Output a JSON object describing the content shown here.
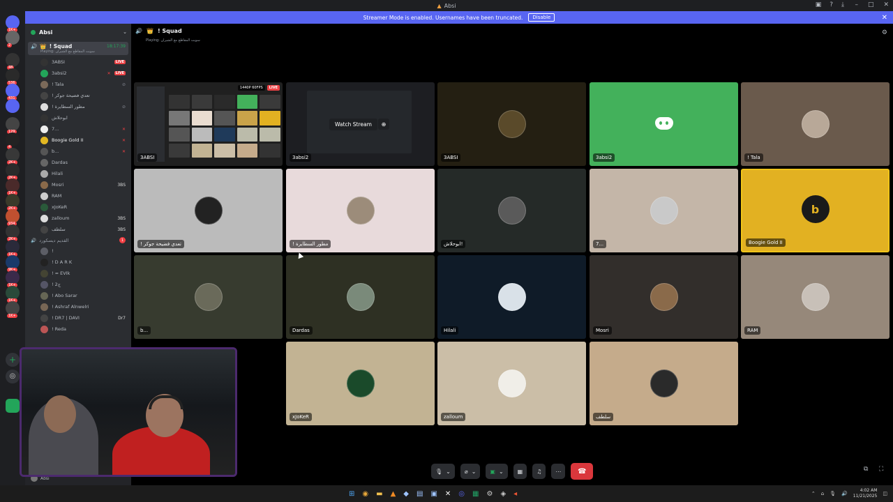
{
  "titlebar": {
    "title": "Absi"
  },
  "banner": {
    "text": "Streamer Mode is enabled. Usernames have been truncated.",
    "disable_label": "Disable"
  },
  "guild_badges": [
    "1K+",
    "2",
    "48",
    "536",
    "431",
    "129",
    "4",
    "2K+",
    "2K+",
    "1K+",
    "2K+",
    "934",
    "2K+",
    "1K+",
    "9K+",
    "1K+",
    "1K+",
    "1K+"
  ],
  "sidebar": {
    "server_name": "Absi",
    "active_channel": {
      "name": "! Squad",
      "time": "18:17:39",
      "status": "Playing: سوبت المقاطع مع الشيران"
    },
    "users": [
      {
        "name": "3ABSI",
        "live": "LIVE",
        "avatar_color": "#ffffff"
      },
      {
        "name": "3absi2",
        "live": "LIVE",
        "avatar_color": "#23a55a"
      },
      {
        "name": "! Tala",
        "live": "",
        "avatar_color": "#7b6a5a"
      },
      {
        "name": "! تعدي فضيحة جوكر",
        "live": "",
        "avatar_color": "#444"
      },
      {
        "name": "! مطور السطايرة",
        "live": "",
        "avatar_color": "#ddd"
      },
      {
        "name": "ابوحلاش",
        "live": "",
        "avatar_color": "#333"
      },
      {
        "name": "7...",
        "live": "",
        "avatar_color": "#eee"
      },
      {
        "name": "Boogie Gold II",
        "live": "",
        "avatar_color": "#e2b722"
      },
      {
        "name": "b...",
        "live": "",
        "avatar_color": "#555"
      },
      {
        "name": "Dardas",
        "live": "",
        "avatar_color": "#666"
      },
      {
        "name": "Hilali",
        "live": "",
        "avatar_color": "#aaa"
      },
      {
        "name": "Mosri",
        "live": "",
        "avatar_color": "#8a6a4a"
      },
      {
        "name": "RAM",
        "live": "",
        "avatar_color": "#ccc"
      },
      {
        "name": "xJoKeR",
        "live": "",
        "avatar_color": "#2a5a3a"
      },
      {
        "name": "zalloum",
        "live": "",
        "avatar_color": "#ddd"
      },
      {
        "name": "سلطف",
        "live": "",
        "avatar_color": "#444"
      }
    ],
    "badge_tags": {
      "mosri": "3BS",
      "zalloum": "3BS",
      "sltf": "3BS",
      "dr7": "Dr7"
    },
    "second_channel": {
      "name": "القديم ديسكورد",
      "badge": "1"
    },
    "second_users": [
      {
        "name": "!"
      },
      {
        "name": "! D A R K"
      },
      {
        "name": "! ≈ EVIk"
      },
      {
        "name": "! 2ج"
      },
      {
        "name": "! Abo Sarar"
      },
      {
        "name": "! Ashraf Alnwelri"
      },
      {
        "name": "! DR7 | DAVI"
      },
      {
        "name": "! Reda"
      }
    ],
    "panel_user": "Absi"
  },
  "voice": {
    "channel": "! Squad",
    "subtitle": "Playing: سوبت المقاطع مع الشيران"
  },
  "tiles": [
    {
      "label": "3ABSI",
      "type": "stream",
      "bg": "#202020",
      "quality": "1440P 60FPS",
      "live": "LIVE"
    },
    {
      "label": "3absi2",
      "type": "stream-preview",
      "bg": "#1d1e22",
      "watch": "Watch Stream"
    },
    {
      "label": "3ABSI",
      "type": "avatar",
      "bg": "#241f12",
      "avatar": "#5a4a2a"
    },
    {
      "label": "3absi2",
      "type": "discord",
      "bg": "#43b15b"
    },
    {
      "label": "! Tala",
      "type": "avatar",
      "bg": "#6a5a4c",
      "avatar": "#b8a898"
    },
    {
      "label": "! تعدي فضيحة جوكر",
      "type": "avatar",
      "bg": "#bbbbbb",
      "avatar": "#222"
    },
    {
      "label": "! مطور السطايرة",
      "type": "avatar",
      "bg": "#e8dadb",
      "avatar": "#9c8c7a"
    },
    {
      "label": "ابوحلاش!",
      "type": "avatar",
      "bg": "#252a28",
      "avatar": "#5a5a5a"
    },
    {
      "label": "7...",
      "type": "avatar",
      "bg": "#c4b6a8",
      "avatar": "#c9c9c9"
    },
    {
      "label": "Boogie Gold II",
      "type": "boogie",
      "bg": "#e2b122"
    },
    {
      "label": "b...",
      "type": "avatar",
      "bg": "#373b2f",
      "avatar": "#6a6a5a"
    },
    {
      "label": "Dardas",
      "type": "avatar",
      "bg": "#2e3023",
      "avatar": "#7a8a7a"
    },
    {
      "label": "Hilali",
      "type": "avatar",
      "bg": "#0f1b28",
      "avatar": "#d9e1e8"
    },
    {
      "label": "Mosri",
      "type": "avatar",
      "bg": "#322e2b",
      "avatar": "#8a6a4a"
    },
    {
      "label": "RAM",
      "type": "avatar",
      "bg": "#96887a",
      "avatar": "#c8c0b8"
    },
    {
      "label": "xJoKeR",
      "type": "avatar",
      "bg": "#c2b393",
      "avatar": "#1a4a2a"
    },
    {
      "label": "zalloum",
      "type": "avatar",
      "bg": "#cbbea7",
      "avatar": "#f0eee8"
    },
    {
      "label": "سلطف",
      "type": "avatar",
      "bg": "#c5ab8b",
      "avatar": "#2a2a2a"
    }
  ],
  "taskbar": {
    "time": "4:02 AM",
    "date": "11/21/2025"
  }
}
